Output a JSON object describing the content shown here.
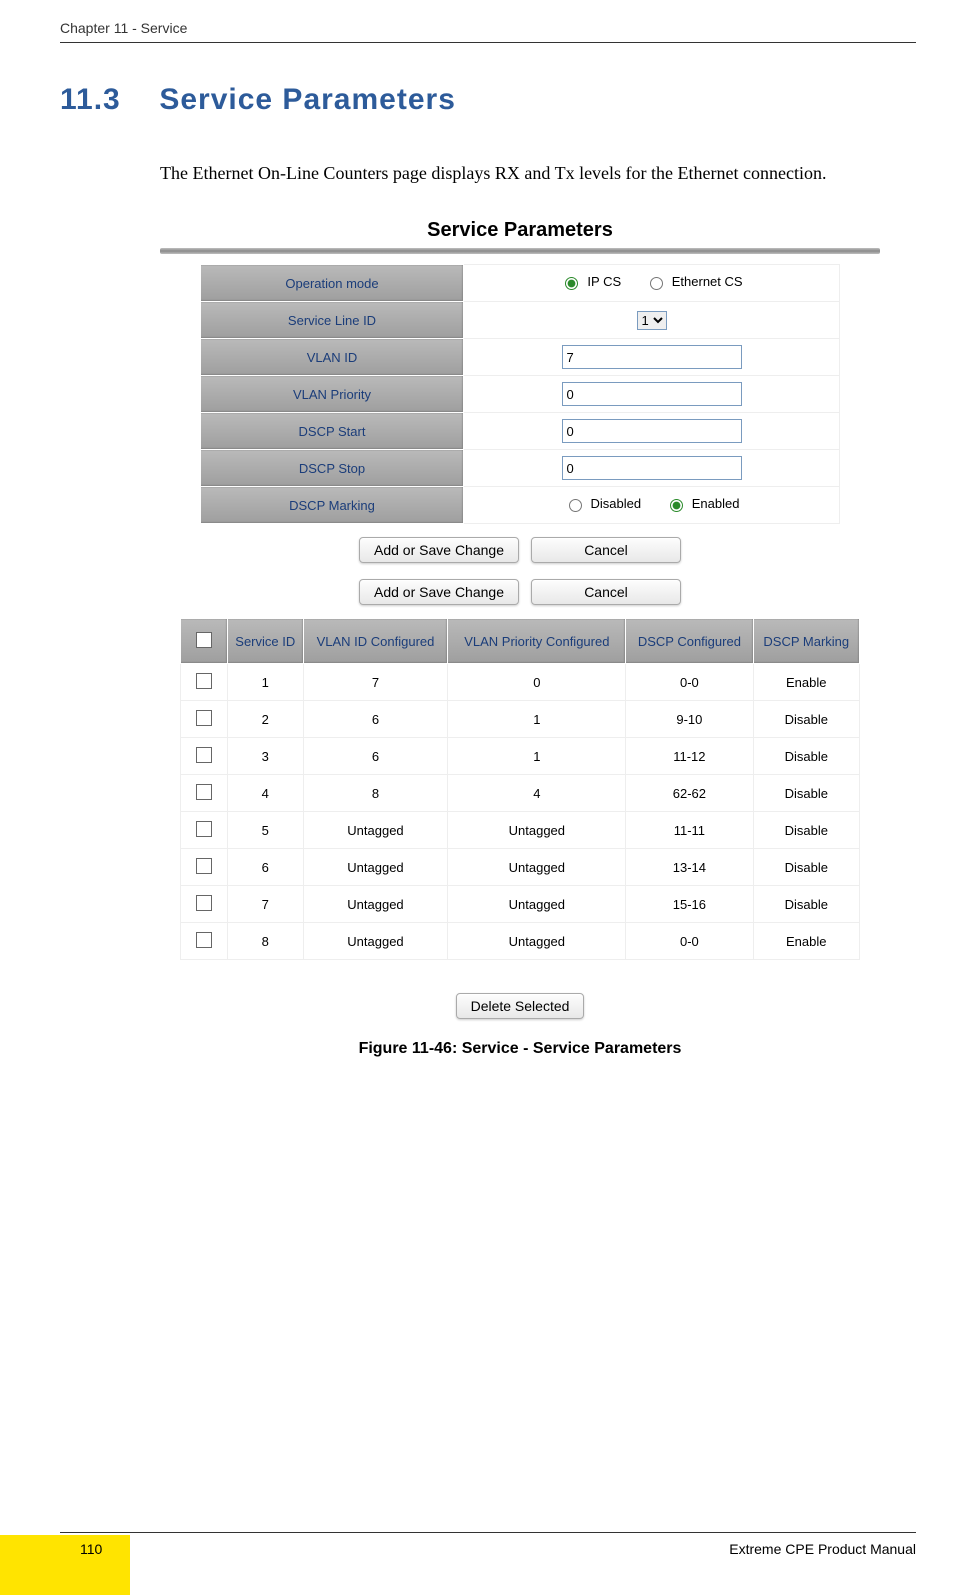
{
  "header": {
    "chapter_line": "Chapter 11 - Service"
  },
  "section": {
    "number": "11.3",
    "title": "Service Parameters"
  },
  "body": {
    "para1": "The Ethernet On-Line Counters page displays RX and Tx levels for the Ethernet connection."
  },
  "panel": {
    "title": "Service Parameters"
  },
  "form": {
    "rows": {
      "op_mode": {
        "label": "Operation mode",
        "opt_ip": "IP CS",
        "opt_eth": "Ethernet CS",
        "selected": "ip"
      },
      "service_id": {
        "label": "Service Line ID",
        "value": "1"
      },
      "vlan_id": {
        "label": "VLAN ID",
        "value": "7"
      },
      "vlan_pri": {
        "label": "VLAN Priority",
        "value": "0"
      },
      "dscp_start": {
        "label": "DSCP Start",
        "value": "0"
      },
      "dscp_stop": {
        "label": "DSCP Stop",
        "value": "0"
      },
      "dscp_mark": {
        "label": "DSCP Marking",
        "opt_dis": "Disabled",
        "opt_en": "Enabled",
        "selected": "enabled"
      }
    }
  },
  "buttons": {
    "add_save": "Add or Save Change",
    "cancel": "Cancel",
    "delete_selected": "Delete Selected"
  },
  "grid": {
    "headers": {
      "checkbox": "",
      "service_id": "Service ID",
      "vlan_id": "VLAN ID Configured",
      "vlan_pri": "VLAN Priority Configured",
      "dscp": "DSCP Configured",
      "marking": "DSCP Marking"
    },
    "rows": [
      {
        "sid": "1",
        "vlan": "7",
        "pri": "0",
        "dscp": "0-0",
        "mark": "Enable"
      },
      {
        "sid": "2",
        "vlan": "6",
        "pri": "1",
        "dscp": "9-10",
        "mark": "Disable"
      },
      {
        "sid": "3",
        "vlan": "6",
        "pri": "1",
        "dscp": "11-12",
        "mark": "Disable"
      },
      {
        "sid": "4",
        "vlan": "8",
        "pri": "4",
        "dscp": "62-62",
        "mark": "Disable"
      },
      {
        "sid": "5",
        "vlan": "Untagged",
        "pri": "Untagged",
        "dscp": "11-11",
        "mark": "Disable"
      },
      {
        "sid": "6",
        "vlan": "Untagged",
        "pri": "Untagged",
        "dscp": "13-14",
        "mark": "Disable"
      },
      {
        "sid": "7",
        "vlan": "Untagged",
        "pri": "Untagged",
        "dscp": "15-16",
        "mark": "Disable"
      },
      {
        "sid": "8",
        "vlan": "Untagged",
        "pri": "Untagged",
        "dscp": "0-0",
        "mark": "Enable"
      }
    ]
  },
  "figure": {
    "caption": "Figure 11-46: Service - Service Parameters"
  },
  "footer": {
    "page_number": "110",
    "manual_title": "Extreme CPE Product Manual"
  }
}
